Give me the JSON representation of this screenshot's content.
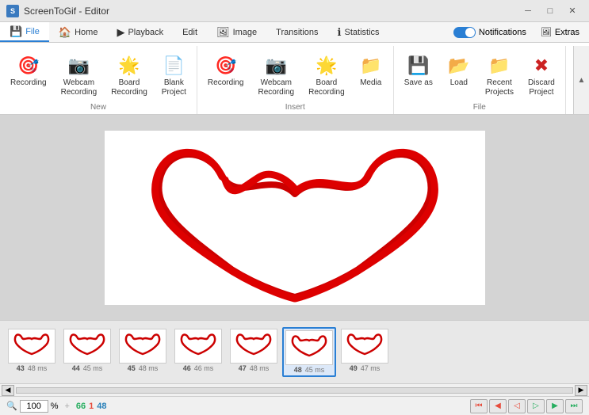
{
  "app": {
    "title": "ScreenToGif - Editor",
    "icon": "S"
  },
  "window_controls": {
    "minimize": "─",
    "maximize": "□",
    "close": "✕"
  },
  "tabs": [
    {
      "id": "file",
      "label": "File",
      "icon": "💾",
      "active": true
    },
    {
      "id": "home",
      "label": "Home",
      "icon": "🏠",
      "active": false
    },
    {
      "id": "playback",
      "label": "Playback",
      "icon": "▶",
      "active": false
    },
    {
      "id": "edit",
      "label": "Edit",
      "icon": "",
      "active": false
    },
    {
      "id": "image",
      "label": "Image",
      "icon": "🖼",
      "active": false
    },
    {
      "id": "transitions",
      "label": "Transitions",
      "icon": "",
      "active": false
    },
    {
      "id": "statistics",
      "label": "Statistics",
      "icon": "ℹ",
      "active": false
    }
  ],
  "toggles": {
    "notifications_label": "Notifications",
    "extras_label": "Extras"
  },
  "ribbon": {
    "groups": [
      {
        "id": "new",
        "label": "New",
        "buttons": [
          {
            "id": "recording",
            "label": "Recording",
            "icon": "🎯",
            "icon_color": "icon-red"
          },
          {
            "id": "webcam-recording",
            "label": "Webcam\nRecording",
            "icon": "📷",
            "icon_color": "icon-gray"
          },
          {
            "id": "board-recording",
            "label": "Board\nRecording",
            "icon": "🌟",
            "icon_color": "icon-teal"
          },
          {
            "id": "blank-project",
            "label": "Blank\nProject",
            "icon": "📄",
            "icon_color": "icon-gray"
          }
        ]
      },
      {
        "id": "insert",
        "label": "Insert",
        "buttons": [
          {
            "id": "recording2",
            "label": "Recording",
            "icon": "🎯",
            "icon_color": "icon-red"
          },
          {
            "id": "webcam-recording2",
            "label": "Webcam\nRecording",
            "icon": "📷",
            "icon_color": "icon-gray"
          },
          {
            "id": "board-recording2",
            "label": "Board\nRecording",
            "icon": "🌟",
            "icon_color": "icon-teal"
          },
          {
            "id": "media",
            "label": "Media",
            "icon": "📁",
            "icon_color": "icon-orange"
          }
        ]
      },
      {
        "id": "file-group",
        "label": "File",
        "buttons": [
          {
            "id": "save-as",
            "label": "Save as",
            "icon": "💾",
            "icon_color": "icon-purple"
          },
          {
            "id": "load",
            "label": "Load",
            "icon": "📂",
            "icon_color": "icon-green"
          },
          {
            "id": "recent-projects",
            "label": "Recent\nProjects",
            "icon": "📁",
            "icon_color": "icon-orange"
          },
          {
            "id": "discard-project",
            "label": "Discard\nProject",
            "icon": "✖",
            "icon_color": "icon-red"
          }
        ]
      }
    ]
  },
  "frames": [
    {
      "num": 43,
      "ms": 48,
      "selected": false
    },
    {
      "num": 44,
      "ms": 45,
      "selected": false
    },
    {
      "num": 45,
      "ms": 48,
      "selected": false
    },
    {
      "num": 46,
      "ms": 46,
      "selected": false
    },
    {
      "num": 47,
      "ms": 48,
      "selected": false
    },
    {
      "num": 48,
      "ms": 45,
      "selected": true
    },
    {
      "num": 49,
      "ms": 47,
      "selected": false
    }
  ],
  "status": {
    "zoom_percent": "100",
    "zoom_symbol": "%",
    "val1": "66",
    "val2": "1",
    "val3": "48",
    "search_placeholder": ""
  },
  "nav_buttons": {
    "first": "⏮",
    "prev_back": "◀",
    "play_back": "◁",
    "play_fwd": "▷",
    "next_fwd": "▶",
    "last": "⏭"
  }
}
